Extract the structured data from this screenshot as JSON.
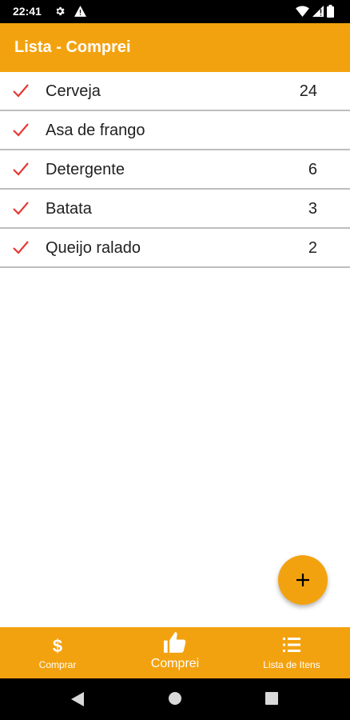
{
  "status_bar": {
    "time": "22:41",
    "icons": [
      "gear-icon",
      "warning-icon",
      "wifi-icon",
      "signal-icon",
      "battery-icon"
    ]
  },
  "app_bar": {
    "title": "Lista - Comprei"
  },
  "items": [
    {
      "name": "Cerveja",
      "qty": "24"
    },
    {
      "name": "Asa de frango",
      "qty": ""
    },
    {
      "name": "Detergente",
      "qty": "6"
    },
    {
      "name": "Batata",
      "qty": "3"
    },
    {
      "name": "Queijo ralado",
      "qty": "2"
    }
  ],
  "fab": {
    "icon": "plus-icon"
  },
  "bottom_nav": {
    "comprar": {
      "label": "Comprar",
      "icon": "dollar-icon"
    },
    "comprei": {
      "label": "Comprei",
      "icon": "thumbs-up-icon",
      "selected": true
    },
    "lista": {
      "label": "Lista de Itens",
      "icon": "list-icon"
    }
  },
  "colors": {
    "accent": "#f3a20f",
    "check": "#e53935",
    "divider": "#bdbdbd",
    "text": "#212121"
  }
}
